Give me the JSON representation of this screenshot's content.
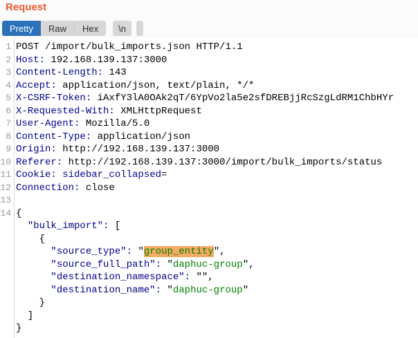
{
  "panel": {
    "title": "Request"
  },
  "toolbar": {
    "tabs": [
      {
        "label": "Pretty",
        "selected": true
      },
      {
        "label": "Raw",
        "selected": false
      },
      {
        "label": "Hex",
        "selected": false
      }
    ],
    "newline_button_label": "\\n",
    "menu_icon": "hamburger-icon"
  },
  "colors": {
    "title_orange": "#ed5b2c",
    "selected_tab_blue": "#2b72b8",
    "button_gray": "#d7d7d7",
    "header_name_navy": "#00008b",
    "string_green": "#008000",
    "selection_highlight": "#f5ab63",
    "line_number_gray": "#9b9b9b"
  },
  "editor": {
    "lines": [
      {
        "n": "1",
        "seg": [
          [
            "p",
            "POST /import/bulk_imports.json HTTP/1.1"
          ]
        ]
      },
      {
        "n": "2",
        "seg": [
          [
            "h",
            "Host:"
          ],
          [
            "p",
            " 192.168.139.137:3000"
          ]
        ]
      },
      {
        "n": "3",
        "seg": [
          [
            "h",
            "Content-Length:"
          ],
          [
            "p",
            " 143"
          ]
        ]
      },
      {
        "n": "4",
        "seg": [
          [
            "h",
            "Accept:"
          ],
          [
            "p",
            " application/json, text/plain, */*"
          ]
        ]
      },
      {
        "n": "5",
        "seg": [
          [
            "h",
            "X-CSRF-Token:"
          ],
          [
            "p",
            " iAxfY3lA0OAk2qT/6YpVo2la5e2sfDREBjjRcSzgLdRM1ChbHYr"
          ]
        ]
      },
      {
        "n": "6",
        "seg": [
          [
            "h",
            "X-Requested-With:"
          ],
          [
            "p",
            " XMLHttpRequest"
          ]
        ]
      },
      {
        "n": "7",
        "seg": [
          [
            "h",
            "User-Agent:"
          ],
          [
            "p",
            " Mozilla/5.0"
          ]
        ]
      },
      {
        "n": "8",
        "seg": [
          [
            "h",
            "Content-Type:"
          ],
          [
            "p",
            " application/json"
          ]
        ]
      },
      {
        "n": "9",
        "seg": [
          [
            "h",
            "Origin:"
          ],
          [
            "p",
            " http://192.168.139.137:3000"
          ]
        ]
      },
      {
        "n": "10",
        "seg": [
          [
            "h",
            "Referer:"
          ],
          [
            "p",
            " http://192.168.139.137:3000/import/bulk_imports/status"
          ]
        ]
      },
      {
        "n": "11",
        "seg": [
          [
            "h",
            "Cookie:"
          ],
          [
            "p",
            " "
          ],
          [
            "h",
            "sidebar_collapsed"
          ],
          [
            "p",
            "="
          ]
        ]
      },
      {
        "n": "12",
        "seg": [
          [
            "h",
            "Connection:"
          ],
          [
            "p",
            " close"
          ]
        ]
      },
      {
        "n": "13",
        "seg": []
      },
      {
        "n": "14",
        "seg": [
          [
            "p",
            "{"
          ]
        ]
      },
      {
        "n": "",
        "seg": [
          [
            "p",
            "  "
          ],
          [
            "h",
            "\"bulk_import\":"
          ],
          [
            "p",
            " ["
          ]
        ]
      },
      {
        "n": "",
        "seg": [
          [
            "p",
            "    {"
          ]
        ]
      },
      {
        "n": "",
        "seg": [
          [
            "p",
            "      "
          ],
          [
            "h",
            "\"source_type\":"
          ],
          [
            "p",
            " \""
          ],
          [
            "hl",
            "group_entity"
          ],
          [
            "p",
            "\","
          ]
        ]
      },
      {
        "n": "",
        "seg": [
          [
            "p",
            "      "
          ],
          [
            "h",
            "\"source_full_path\":"
          ],
          [
            "p",
            " \""
          ],
          [
            "s",
            "daphuc-group"
          ],
          [
            "p",
            "\","
          ]
        ]
      },
      {
        "n": "",
        "seg": [
          [
            "p",
            "      "
          ],
          [
            "h",
            "\"destination_namespace\":"
          ],
          [
            "p",
            " \"\","
          ]
        ]
      },
      {
        "n": "",
        "seg": [
          [
            "p",
            "      "
          ],
          [
            "h",
            "\"destination_name\":"
          ],
          [
            "p",
            " \""
          ],
          [
            "s",
            "daphuc-group"
          ],
          [
            "p",
            "\""
          ]
        ]
      },
      {
        "n": "",
        "seg": [
          [
            "p",
            "    }"
          ]
        ]
      },
      {
        "n": "",
        "seg": [
          [
            "p",
            "  ]"
          ]
        ]
      },
      {
        "n": "",
        "seg": [
          [
            "p",
            "}"
          ]
        ]
      }
    ]
  }
}
